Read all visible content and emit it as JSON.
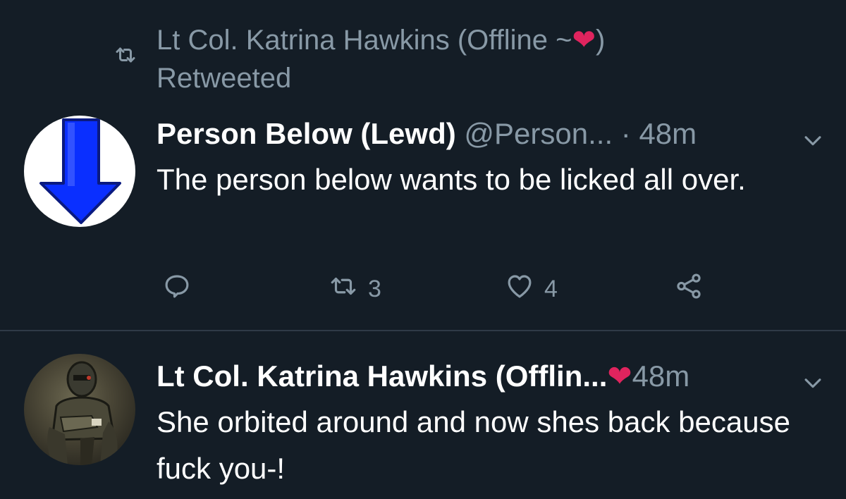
{
  "retweet_context": {
    "label_prefix": "Lt Col. Katrina Hawkins (Offline ~",
    "heart": "❤",
    "label_suffix": ")",
    "action": "Retweeted",
    "icon": "retweet-icon"
  },
  "tweets": [
    {
      "display_name": "Person Below (Lewd)",
      "handle": "@Person...",
      "dot": "·",
      "time": "48m",
      "text": "The person below wants to be licked all over.",
      "avatar": "down-arrow-avatar",
      "actions": {
        "reply_icon": "reply-icon",
        "retweet_icon": "retweet-icon",
        "retweet_count": "3",
        "like_icon": "heart-icon",
        "like_count": "4",
        "share_icon": "share-icon"
      }
    },
    {
      "display_name": "Lt Col. Katrina Hawkins (Offlin...",
      "heart": "❤",
      "time": "48m",
      "text": "She orbited around and now shes back because fuck you-!",
      "avatar": "armored-figure-avatar"
    }
  ],
  "colors": {
    "background": "#141d26",
    "secondary_text": "#8899a6",
    "heart": "#e0245e",
    "divider": "#2f3a47"
  }
}
